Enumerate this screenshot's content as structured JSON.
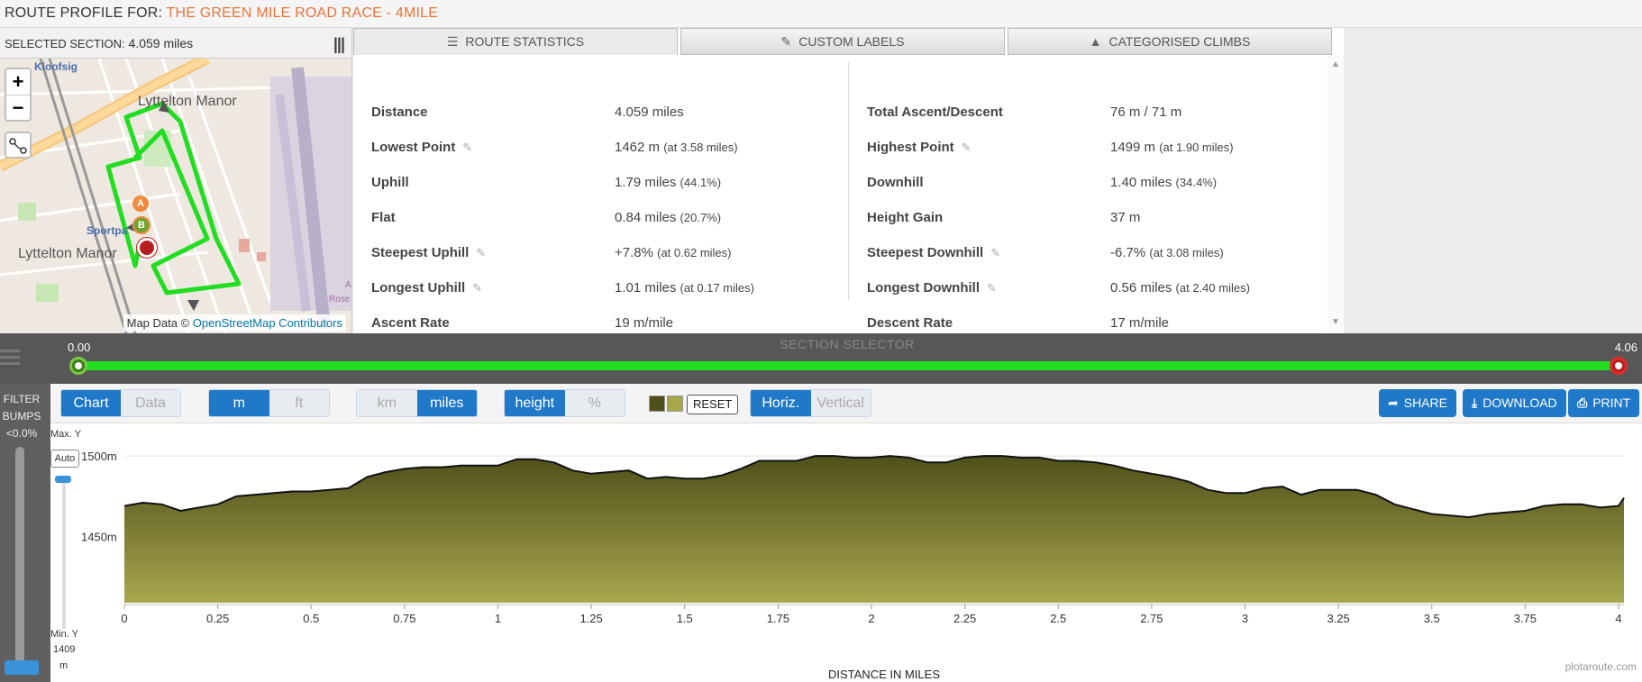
{
  "header": {
    "prefix": "ROUTE PROFILE FOR:",
    "race_name": "THE GREEN MILE ROAD RACE - 4MILE"
  },
  "map": {
    "selected_label": "SELECTED SECTION:",
    "selected_value": "4.059 miles",
    "zoom_in": "+",
    "zoom_out": "−",
    "labels": [
      "Kloofsig",
      "Lyttelton Manor",
      "Sportpa",
      "Lyttelton Manor",
      "Rose",
      "A"
    ],
    "marker_a": "A",
    "marker_b": "B",
    "attribution_prefix": "Map Data ©",
    "attribution_link": "OpenStreetMap Contributors"
  },
  "tabs": [
    {
      "label": "ROUTE STATISTICS",
      "icon": "list-icon",
      "active": true
    },
    {
      "label": "CUSTOM LABELS",
      "icon": "pencil-icon",
      "active": false
    },
    {
      "label": "CATEGORISED CLIMBS",
      "icon": "mountain-icon",
      "active": false
    }
  ],
  "stats_left": [
    {
      "label": "Distance",
      "value": "4.059 miles",
      "detail": "",
      "editable": false
    },
    {
      "label": "Lowest Point",
      "value": "1462 m",
      "detail": "(at 3.58 miles)",
      "editable": true
    },
    {
      "label": "Uphill",
      "value": "1.79 miles",
      "detail": "(44.1%)",
      "editable": false
    },
    {
      "label": "Flat",
      "value": "0.84 miles",
      "detail": "(20.7%)",
      "editable": false
    },
    {
      "label": "Steepest Uphill",
      "value": "+7.8%",
      "detail": "(at 0.62 miles)",
      "editable": true
    },
    {
      "label": "Longest Uphill",
      "value": "1.01 miles",
      "detail": "(at 0.17 miles)",
      "editable": true
    },
    {
      "label": "Ascent Rate",
      "value": "19 m/mile",
      "detail": "",
      "editable": false
    }
  ],
  "stats_right": [
    {
      "label": "Total Ascent/Descent",
      "value": "76 m / 71 m",
      "detail": "",
      "editable": false
    },
    {
      "label": "Highest Point",
      "value": "1499 m",
      "detail": "(at 1.90 miles)",
      "editable": true
    },
    {
      "label": "Downhill",
      "value": "1.40 miles",
      "detail": "(34.4%)",
      "editable": false
    },
    {
      "label": "Height Gain",
      "value": "37 m",
      "detail": "",
      "editable": false
    },
    {
      "label": "Steepest Downhill",
      "value": "-6.7%",
      "detail": "(at 3.08 miles)",
      "editable": true
    },
    {
      "label": "Longest Downhill",
      "value": "0.56 miles",
      "detail": "(at 2.40 miles)",
      "editable": true
    },
    {
      "label": "Descent Rate",
      "value": "17 m/mile",
      "detail": "",
      "editable": false
    }
  ],
  "selector": {
    "title": "SECTION SELECTOR",
    "start_label": "0.00",
    "end_label": "4.06",
    "bar_color": "#22dd22"
  },
  "filter": {
    "line1": "FILTER",
    "line2": "BUMPS",
    "line3": "<0.0%"
  },
  "toolbar": {
    "view": {
      "chart": "Chart",
      "data": "Data"
    },
    "height_unit": {
      "m": "m",
      "ft": "ft"
    },
    "dist_unit": {
      "km": "km",
      "miles": "miles"
    },
    "mode": {
      "height": "height",
      "pct": "%"
    },
    "reset": "RESET",
    "orient": {
      "horiz": "Horiz.",
      "vertical": "Vertical"
    },
    "share": "SHARE",
    "download": "DOWNLOAD",
    "print": "PRINT",
    "swatch_dark": "#4f4f1a",
    "swatch_light": "#a7a74a",
    "accent": "#1f78c8"
  },
  "yaxis_ctl": {
    "max_label": "Max. Y",
    "auto": "Auto",
    "min_label": "Min. Y",
    "min_value": "1409",
    "min_unit": "m"
  },
  "chart_data": {
    "type": "area",
    "xlabel": "DISTANCE IN MILES",
    "ylabel": "",
    "title": "",
    "xlim": [
      0,
      4.059
    ],
    "ylim": [
      1409,
      1509
    ],
    "xticks": [
      "0",
      "0.25",
      "0.5",
      "0.75",
      "1",
      "1.25",
      "1.5",
      "1.75",
      "2",
      "2.25",
      "2.5",
      "2.75",
      "3",
      "3.25",
      "3.5",
      "3.75",
      "4"
    ],
    "yticks": [
      {
        "value": 1500,
        "label": "1500m"
      },
      {
        "value": 1450,
        "label": "1450m"
      }
    ],
    "grid": true,
    "fill_top": "#4f4f1a",
    "fill_bottom": "#a9a84f",
    "x": [
      0,
      0.05,
      0.1,
      0.15,
      0.2,
      0.25,
      0.3,
      0.35,
      0.4,
      0.45,
      0.5,
      0.55,
      0.6,
      0.65,
      0.7,
      0.75,
      0.8,
      0.85,
      0.9,
      0.95,
      1.0,
      1.05,
      1.1,
      1.15,
      1.2,
      1.25,
      1.3,
      1.35,
      1.4,
      1.45,
      1.5,
      1.55,
      1.6,
      1.65,
      1.7,
      1.75,
      1.8,
      1.85,
      1.9,
      1.95,
      2.0,
      2.05,
      2.1,
      2.15,
      2.2,
      2.25,
      2.3,
      2.35,
      2.4,
      2.45,
      2.5,
      2.55,
      2.6,
      2.65,
      2.7,
      2.75,
      2.8,
      2.85,
      2.9,
      2.95,
      3.0,
      3.05,
      3.1,
      3.15,
      3.2,
      3.25,
      3.3,
      3.35,
      3.4,
      3.45,
      3.5,
      3.55,
      3.6,
      3.65,
      3.7,
      3.75,
      3.8,
      3.85,
      3.9,
      3.95,
      4.0,
      4.059
    ],
    "y": [
      1469,
      1471,
      1470,
      1466,
      1468,
      1470,
      1475,
      1476,
      1477,
      1478,
      1478,
      1479,
      1480,
      1487,
      1490,
      1492,
      1493,
      1493,
      1494,
      1494,
      1494,
      1498,
      1498,
      1496,
      1491,
      1489,
      1490,
      1491,
      1486,
      1487,
      1486,
      1486,
      1488,
      1492,
      1497,
      1497,
      1497,
      1500,
      1500,
      1499,
      1499,
      1500,
      1499,
      1496,
      1496,
      1499,
      1500,
      1500,
      1499,
      1499,
      1497,
      1497,
      1496,
      1494,
      1491,
      1489,
      1487,
      1484,
      1479,
      1477,
      1477,
      1480,
      1481,
      1476,
      1479,
      1479,
      1479,
      1476,
      1470,
      1467,
      1464,
      1463,
      1462,
      1464,
      1465,
      1466,
      1469,
      1470,
      1470,
      1468,
      1469,
      1474
    ]
  },
  "watermark": "plotaroute.com"
}
